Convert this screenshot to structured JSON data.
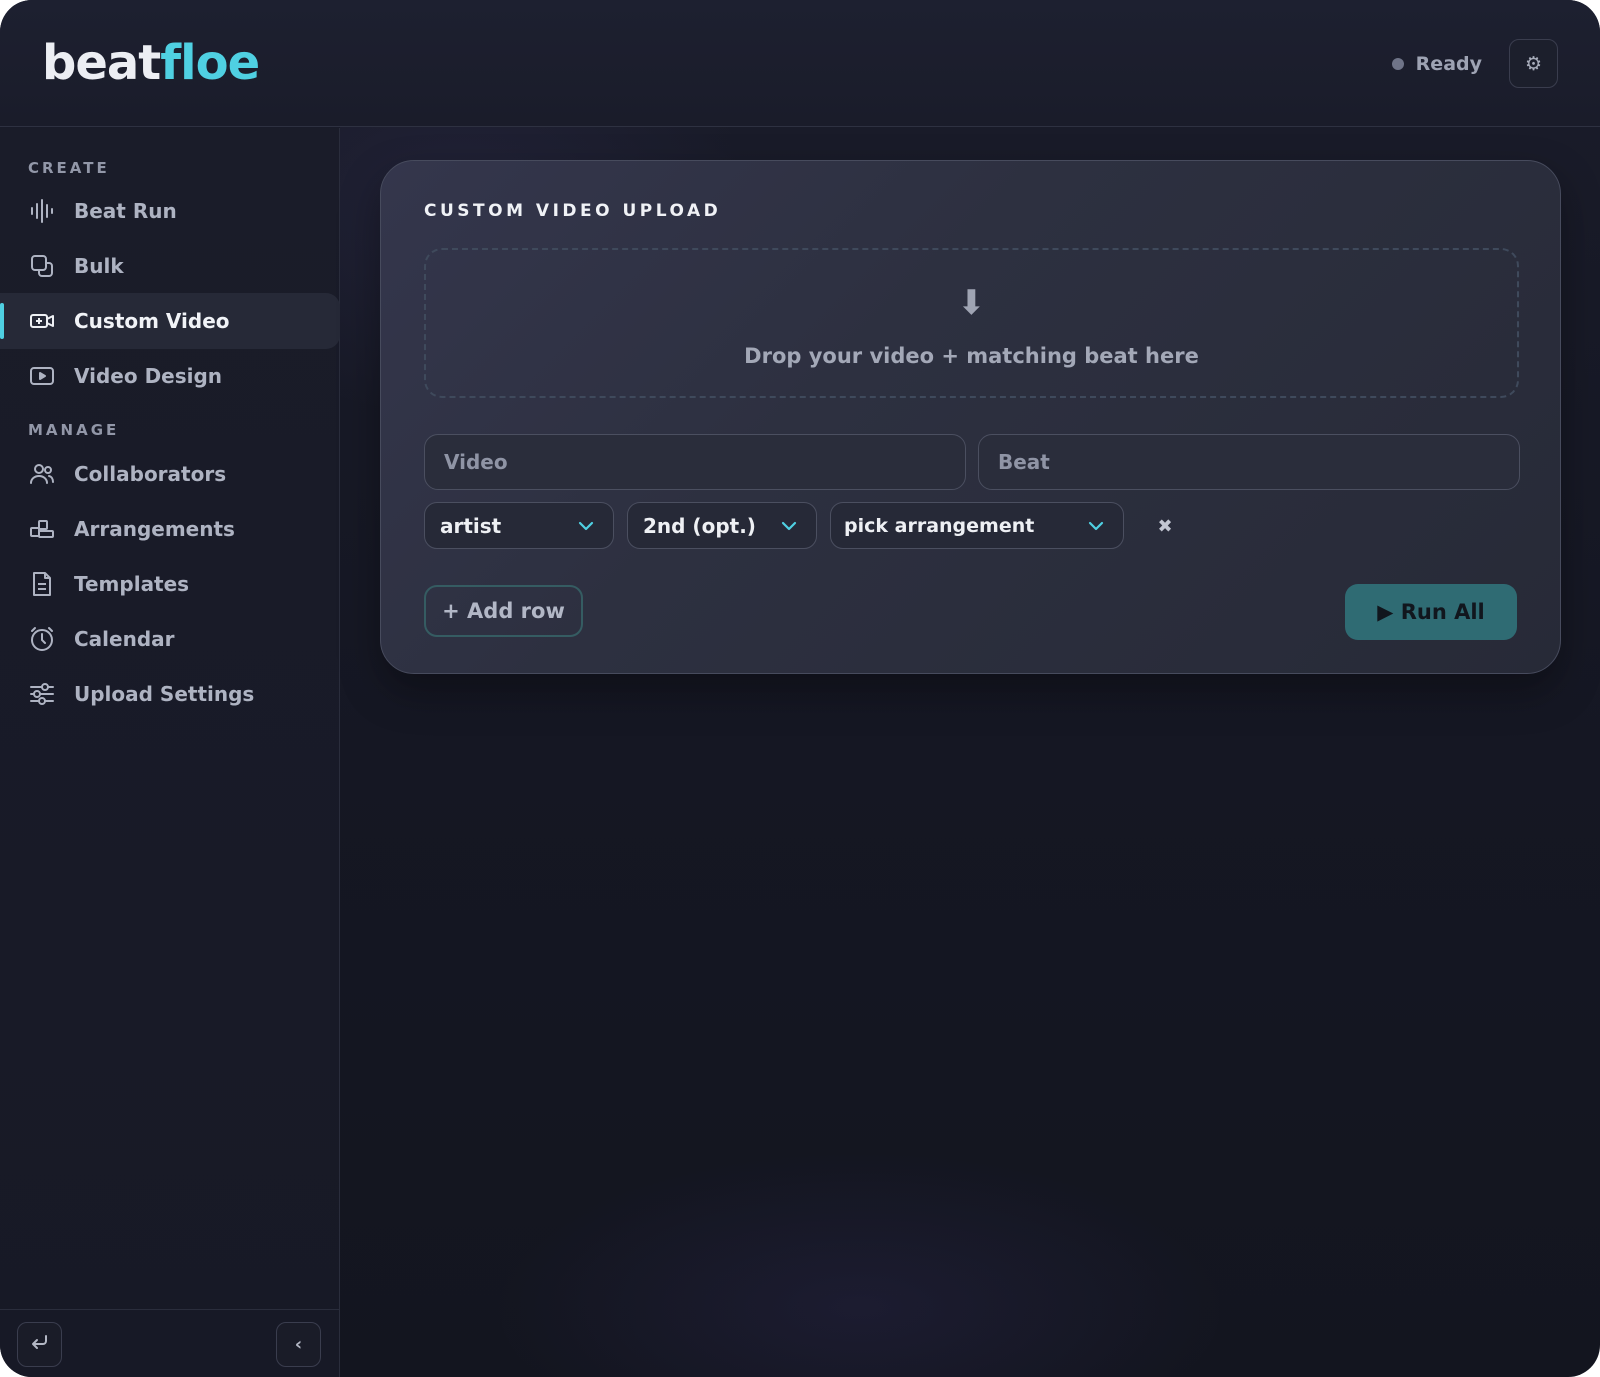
{
  "app": {
    "logo_part1": "beat",
    "logo_part2": "floe",
    "status": "Ready",
    "accent_color": "#4fd0e2"
  },
  "header": {
    "settings_icon": "gear-icon"
  },
  "sidebar": {
    "sections": [
      {
        "label": "CREATE",
        "items": [
          {
            "label": "Beat Run",
            "icon": "waveform-icon",
            "active": false
          },
          {
            "label": "Bulk",
            "icon": "stack-icon",
            "active": false
          },
          {
            "label": "Custom Video",
            "icon": "video-camera-icon",
            "active": true
          },
          {
            "label": "Video Design",
            "icon": "play-screen-icon",
            "active": false
          }
        ]
      },
      {
        "label": "MANAGE",
        "items": [
          {
            "label": "Collaborators",
            "icon": "users-icon",
            "active": false
          },
          {
            "label": "Arrangements",
            "icon": "blocks-icon",
            "active": false
          },
          {
            "label": "Templates",
            "icon": "document-icon",
            "active": false
          },
          {
            "label": "Calendar",
            "icon": "clock-icon",
            "active": false
          },
          {
            "label": "Upload Settings",
            "icon": "sliders-icon",
            "active": false
          }
        ]
      }
    ],
    "footer": {
      "back_icon": "return-icon",
      "collapse_icon": "chevron-left-icon",
      "collapse_glyph": "‹"
    }
  },
  "card": {
    "title": "CUSTOM VIDEO UPLOAD",
    "dropzone": {
      "icon": "download-arrow-icon",
      "glyph": "⬇",
      "text": "Drop your video + matching beat here"
    },
    "video_placeholder": "Video",
    "beat_placeholder": "Beat",
    "selects": {
      "artist": "artist",
      "second": "2nd (opt.)",
      "arrangement": "pick arrangement"
    },
    "remove_glyph": "✖",
    "add_row_label": "+ Add row",
    "run_all_label": "▶ Run All"
  }
}
